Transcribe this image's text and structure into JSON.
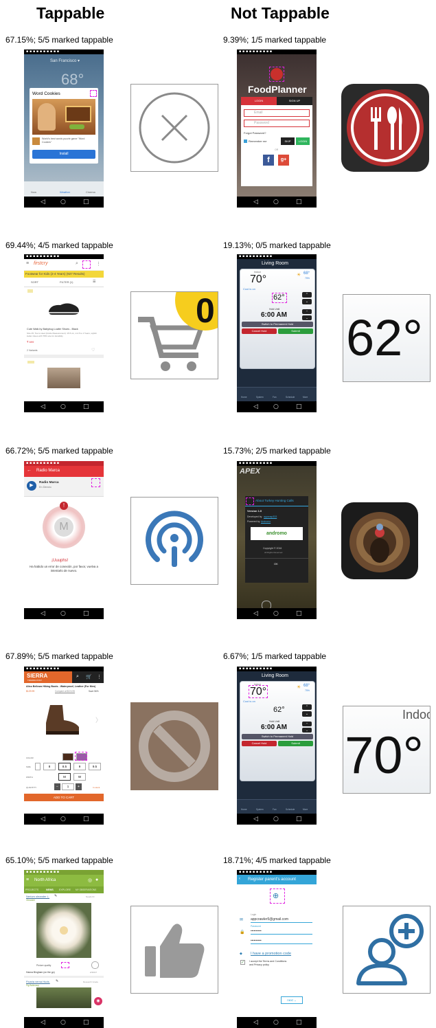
{
  "headers": {
    "tappable": "Tappable",
    "not_tappable": "Not Tappable"
  },
  "rows": [
    {
      "left": {
        "caption": "67.15%; 5/5 marked tappable",
        "screen": {
          "city": "San Francisco ▾",
          "temp": "68°",
          "dialog_title": "Word Cookies",
          "app_desc": "World's best words puzzle game \"Word Cookies\"",
          "install_button": "Install",
          "tabs": [
            "Now",
            "Weather",
            "Cinema"
          ]
        },
        "crop_icon": "close-circle-icon"
      },
      "right": {
        "caption": "9.39%; 1/5 marked tappable",
        "screen": {
          "app_title": "FoodPlanner",
          "login_tab": "LOGIN",
          "signup_tab": "SIGN UP",
          "email_placeholder": "Email",
          "password_placeholder": "Password",
          "forgot_password": "Forgot Password?",
          "remember_me": "Remember me",
          "skip_button": "SKIP",
          "login_button": "LOGIN",
          "or_divider": "OR",
          "facebook": "f",
          "google": "g+"
        },
        "crop_icon": "restaurant-cutlery-icon"
      }
    },
    {
      "left": {
        "caption": "69.44%; 4/5 marked tappable",
        "screen": {
          "brand": "firstcry",
          "banner": "Footwear for Kids (2-4 Years) (927 Results)",
          "sort_label": "SORT",
          "filter_label": "FILTER (1)",
          "product_name": "Cute Walk by Babyhug Loafer Shoes - Black",
          "product_desc": "Size 25, Toe to Heel (Inside Measurement): 15.5 cm, 2-2.5 to 3 Years, stylish loafer shoes with TPR sole for durability",
          "price": "₹ 699",
          "variants": "2 Variants"
        },
        "crop_icon": "cart-badge-icon",
        "crop_badge": "0"
      },
      "right": {
        "caption": "19.13%; 0/5 marked tappable",
        "screen": {
          "room": "Living Room",
          "indoor_label": "Indoor",
          "indoor_temp": "70°",
          "outdoor_temp": "68°",
          "humidity": "75%",
          "status": "Cool is on",
          "setpoint": "62°",
          "hold_label": "Hold Until",
          "hold_time": "6:00 AM",
          "permanent_hold": "Switch to Permanent Hold",
          "cancel_hold": "Cancel Hold",
          "submit": "Submit",
          "tabs": [
            "Home",
            "System",
            "Fan",
            "Schedule",
            "More"
          ]
        },
        "crop_text": "62°"
      }
    },
    {
      "left": {
        "caption": "66.72%; 5/5 marked tappable",
        "screen": {
          "toolbar_title": "Radio Marca",
          "station_name": "Radio Marca",
          "station_sub": "En Directo",
          "error_title": "¡Uuuphs!",
          "error_message": "Ha habido un error de conexión, por favor, vuelva a intentarlo de nuevo."
        },
        "crop_icon": "podcast-info-icon"
      },
      "right": {
        "caption": "15.73%; 2/5 marked tappable",
        "screen": {
          "brand": "APEX",
          "dialog_title": "About Turkey Hunting Calls",
          "version": "Version 1.0",
          "developed_by": "Developed by",
          "developer": "appsnap333",
          "powered_by": "Powered by",
          "powered_link": "Andromo",
          "andromo_logo": "andromo",
          "copyright": "Copyright © 2016",
          "rights": "All Rights Reserved",
          "ok_button": "OK"
        },
        "crop_icon": "turkey-photo-icon"
      }
    },
    {
      "left": {
        "caption": "67.89%; 5/5 marked tappable",
        "screen": {
          "brand": "SIERRA",
          "brand_sub": "TRADING POST",
          "product_title": "Alico Bellows Hiking Boots - Waterproof, Leather (For Men)",
          "price": "$129.99",
          "compare": "Compare at $224.95",
          "save": "Save 56%",
          "color_label": "COLOR",
          "size_label": "SIZE",
          "sizes": [
            "8",
            "8.5",
            "9",
            "9.5"
          ],
          "width_label": "WIDTH",
          "widths": [
            "M",
            "W"
          ],
          "quantity_label": "QUANTITY",
          "quantity": "1",
          "in_stock": "In stock",
          "add_to_cart": "ADD TO CART"
        },
        "crop_icon": "prohibited-icon"
      },
      "right": {
        "caption": "6.67%; 1/5 marked tappable",
        "screen": {
          "room": "Living Room",
          "indoor_label": "Indoor",
          "indoor_temp": "70°",
          "outdoor_temp": "68°",
          "humidity": "75%",
          "status": "Cool is on",
          "setpoint": "62°",
          "hold_label": "Hold Until",
          "hold_time": "6:00 AM",
          "permanent_hold": "Switch to Permanent Hold",
          "cancel_hold": "Cancel Hold",
          "submit": "Submit",
          "tabs": [
            "Home",
            "System",
            "Fan",
            "Schedule",
            "More"
          ]
        },
        "crop_label": "Indoo",
        "crop_text": "70°"
      }
    },
    {
      "left": {
        "caption": "65.10%; 5/5 marked tappable",
        "screen": {
          "toolbar_title": "North Africa",
          "tabs": [
            "PROJECTS",
            "NEWS",
            "EXPLORE",
            "MY OBSERVATIONS"
          ],
          "obs1_name": "Nerium oleander L.",
          "obs1_common": "Oleander",
          "obs1_status": "Needs ID",
          "quality": "Picture quality",
          "observer": "Hanna Bingham (on the go)",
          "date": "2/16/17",
          "obs2_name": "Ficaria verna Huds.",
          "obs2_common": "Fig Buttercup",
          "obs2_status": "Research Grade"
        },
        "crop_icon": "thumbs-up-icon"
      },
      "right": {
        "caption": "18.71%; 4/5 marked tappable",
        "screen": {
          "toolbar_title": "Register parent's account",
          "login_label": "Login",
          "email": "appcrawler5@gmail.com",
          "password_label": "Password",
          "password_value": "••••••••••",
          "password_confirm": "••••••••••",
          "promo_link": "I have a promotion code",
          "accept_text": "I accept the Terms and Conditions and Privacy policy",
          "next_button": "next"
        },
        "crop_icon": "add-user-icon"
      }
    }
  ]
}
